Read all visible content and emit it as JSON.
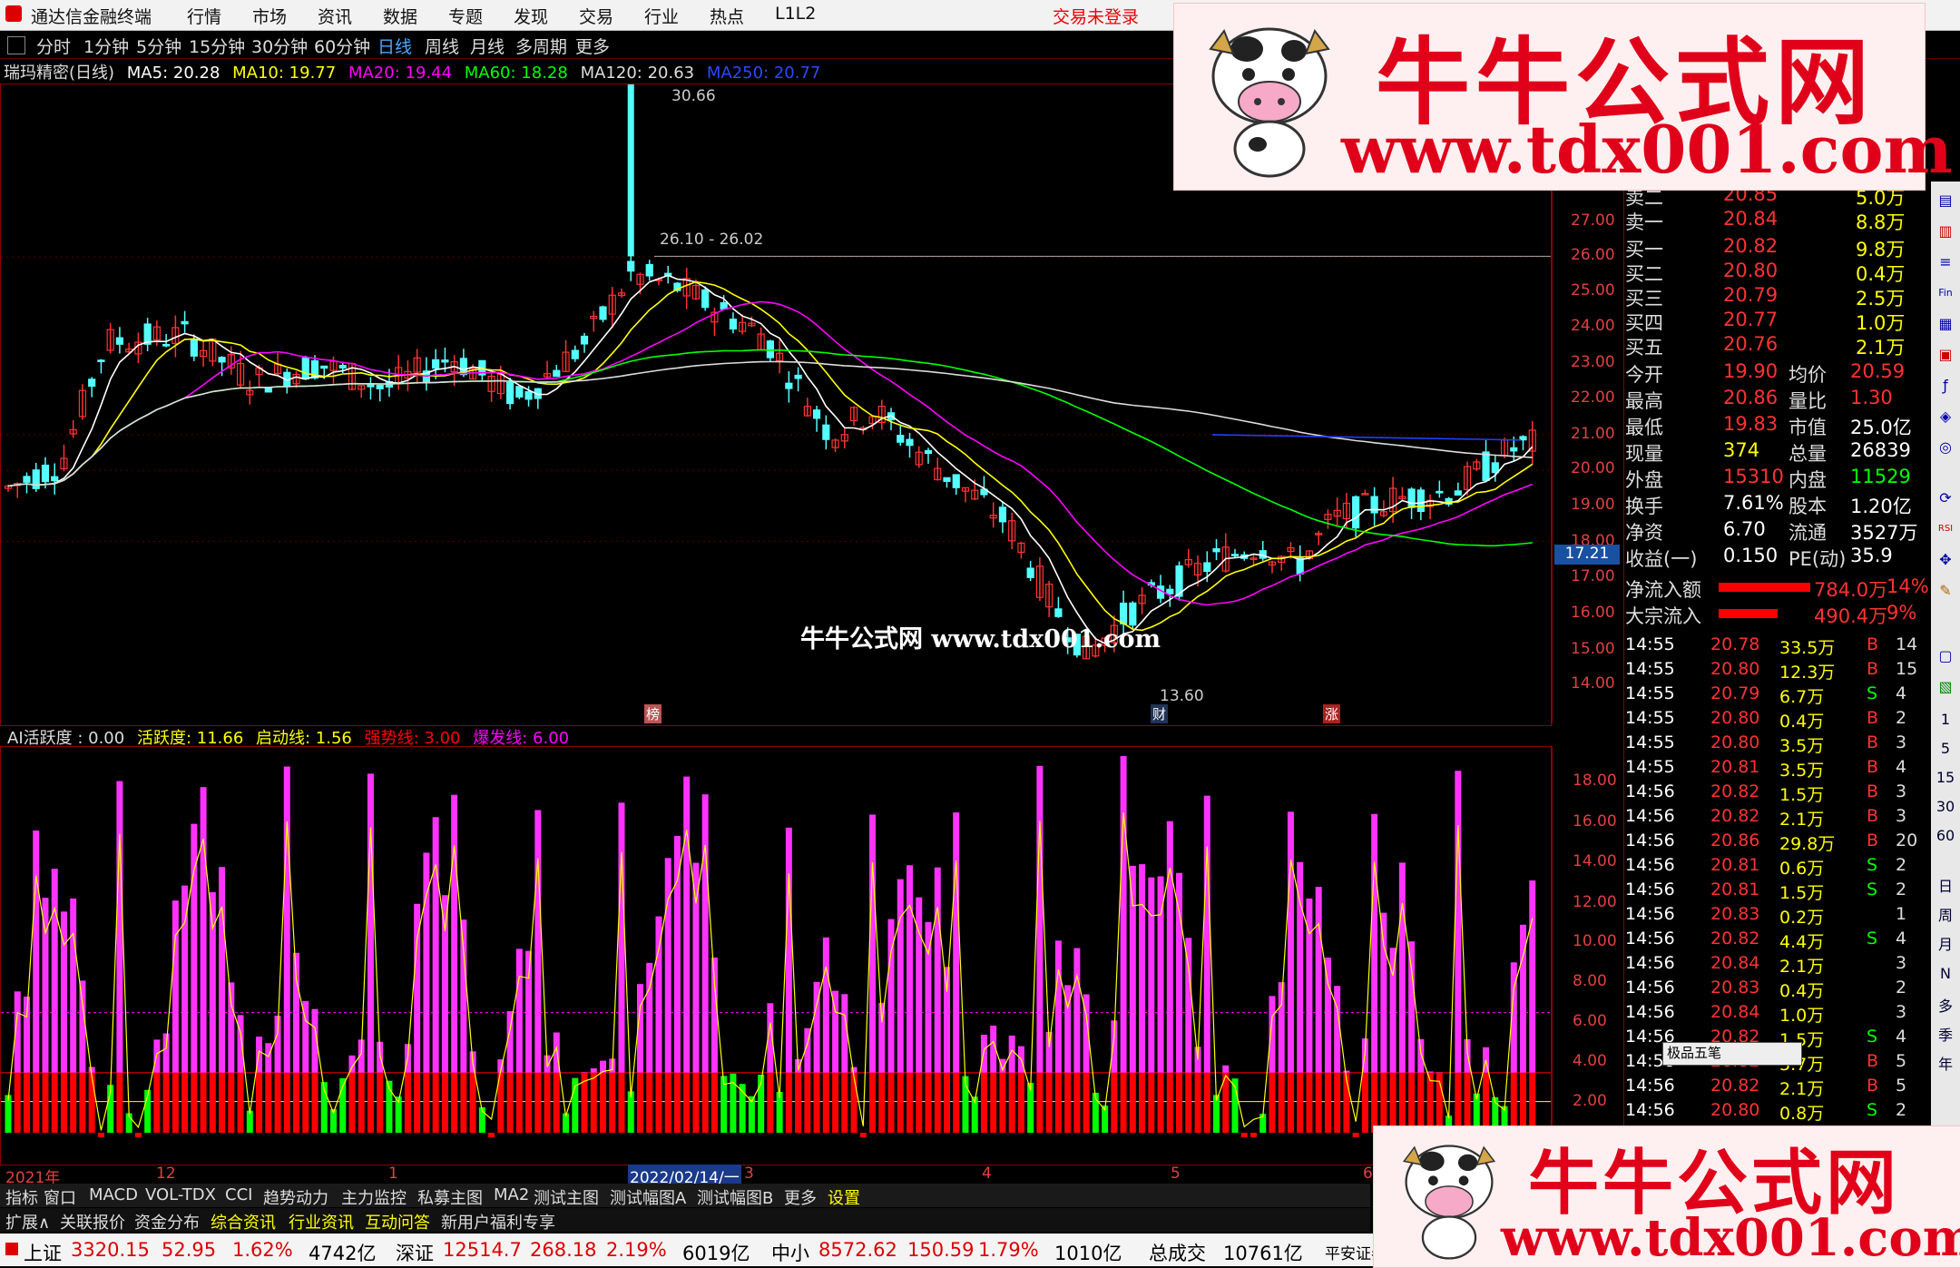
{
  "app": {
    "title": "通达信金融终端",
    "menu": [
      "行情",
      "市场",
      "资讯",
      "数据",
      "专题",
      "发现",
      "交易",
      "行业",
      "热点",
      "L1L2"
    ],
    "trade_status": "交易未登录"
  },
  "periods": [
    "分时",
    "1分钟",
    "5分钟",
    "15分钟",
    "30分钟",
    "60分钟",
    "日线",
    "周线",
    "月线",
    "多周期",
    "更多"
  ],
  "active_period": "日线",
  "ma_legend": {
    "stock": "瑞玛精密(日线)",
    "ma5": "MA5: 20.28",
    "ma10": "MA10: 19.77",
    "ma20": "MA20: 19.44",
    "ma60": "MA60: 18.28",
    "ma120": "MA120: 20.63",
    "ma250": "MA250: 20.77"
  },
  "price_axis": [
    "27.00",
    "26.00",
    "25.00",
    "24.00",
    "23.00",
    "22.00",
    "21.00",
    "20.00",
    "19.00",
    "18.00",
    "17.00",
    "16.00",
    "15.00",
    "14.00"
  ],
  "price_marker": "17.21",
  "annotations": {
    "high": "30.66",
    "range": "26.10 - 26.02",
    "low": "13.60",
    "event1": "榜",
    "event2": "财",
    "event3": "涨"
  },
  "watermark_center": "牛牛公式网 www.tdx001.com",
  "indicator_legend": {
    "name": "AI活跃度 : 0.00",
    "active": "活跃度: 11.66",
    "start": "启动线: 1.56",
    "strong": "强势线: 3.00",
    "burst": "爆发线: 6.00"
  },
  "indicator_axis": [
    "18.00",
    "16.00",
    "14.00",
    "12.00",
    "10.00",
    "8.00",
    "6.00",
    "4.00",
    "2.00"
  ],
  "time_axis": [
    "2021年",
    "12",
    "1",
    "2022/02/14/一",
    "3",
    "4",
    "5",
    "6"
  ],
  "quote": {
    "sell_rows": [
      {
        "label": "卖二",
        "price": "20.85",
        "vol": "5.0万"
      },
      {
        "label": "卖一",
        "price": "20.84",
        "vol": "8.8万"
      }
    ],
    "buy_rows": [
      {
        "label": "买一",
        "price": "20.82",
        "vol": "9.8万"
      },
      {
        "label": "买二",
        "price": "20.80",
        "vol": "0.4万"
      },
      {
        "label": "买三",
        "price": "20.79",
        "vol": "2.5万"
      },
      {
        "label": "买四",
        "price": "20.77",
        "vol": "1.0万"
      },
      {
        "label": "买五",
        "price": "20.76",
        "vol": "2.1万"
      }
    ],
    "stats": [
      {
        "l1": "今开",
        "v1": "19.90",
        "l2": "均价",
        "v2": "20.59"
      },
      {
        "l1": "最高",
        "v1": "20.86",
        "l2": "量比",
        "v2": "1.30"
      },
      {
        "l1": "最低",
        "v1": "19.83",
        "l2": "市值",
        "v2": "25.0亿"
      },
      {
        "l1": "现量",
        "v1": "374",
        "l2": "总量",
        "v2": "26839"
      },
      {
        "l1": "外盘",
        "v1": "15310",
        "l2": "内盘",
        "v2": "11529"
      },
      {
        "l1": "换手",
        "v1": "7.61%",
        "l2": "股本",
        "v2": "1.20亿"
      },
      {
        "l1": "净资",
        "v1": "6.70",
        "l2": "流通",
        "v2": "3527万"
      },
      {
        "l1": "收益(一)",
        "v1": "0.150",
        "l2": "PE(动)",
        "v2": "35.9"
      }
    ],
    "flows": [
      {
        "label": "净流入额",
        "value": "784.0万",
        "pct": "14%",
        "level": 0.14
      },
      {
        "label": "大宗流入",
        "value": "490.4万",
        "pct": "9%",
        "level": 0.09
      }
    ]
  },
  "ticks": [
    {
      "t": "14:55",
      "p": "20.78",
      "v": "33.5万",
      "d": "B",
      "n": "14"
    },
    {
      "t": "14:55",
      "p": "20.80",
      "v": "12.3万",
      "d": "B",
      "n": "15"
    },
    {
      "t": "14:55",
      "p": "20.79",
      "v": "6.7万",
      "d": "S",
      "n": "4"
    },
    {
      "t": "14:55",
      "p": "20.80",
      "v": "0.4万",
      "d": "B",
      "n": "2"
    },
    {
      "t": "14:55",
      "p": "20.80",
      "v": "3.5万",
      "d": "B",
      "n": "3"
    },
    {
      "t": "14:55",
      "p": "20.81",
      "v": "3.5万",
      "d": "B",
      "n": "4"
    },
    {
      "t": "14:56",
      "p": "20.82",
      "v": "1.5万",
      "d": "B",
      "n": "3"
    },
    {
      "t": "14:56",
      "p": "20.82",
      "v": "2.1万",
      "d": "B",
      "n": "3"
    },
    {
      "t": "14:56",
      "p": "20.86",
      "v": "29.8万",
      "d": "B",
      "n": "20"
    },
    {
      "t": "14:56",
      "p": "20.81",
      "v": "0.6万",
      "d": "S",
      "n": "2"
    },
    {
      "t": "14:56",
      "p": "20.81",
      "v": "1.5万",
      "d": "S",
      "n": "2"
    },
    {
      "t": "14:56",
      "p": "20.83",
      "v": "0.2万",
      "d": "",
      "n": "1"
    },
    {
      "t": "14:56",
      "p": "20.82",
      "v": "4.4万",
      "d": "S",
      "n": "4"
    },
    {
      "t": "14:56",
      "p": "20.84",
      "v": "2.1万",
      "d": "",
      "n": "3"
    },
    {
      "t": "14:56",
      "p": "20.83",
      "v": "0.4万",
      "d": "",
      "n": "2"
    },
    {
      "t": "14:56",
      "p": "20.84",
      "v": "1.0万",
      "d": "",
      "n": "3"
    },
    {
      "t": "14:56",
      "p": "20.82",
      "v": "1.5万",
      "d": "S",
      "n": "4"
    },
    {
      "t": "14:56",
      "p": "20.82",
      "v": "3.7万",
      "d": "B",
      "n": "5"
    },
    {
      "t": "14:56",
      "p": "20.82",
      "v": "2.1万",
      "d": "B",
      "n": "5"
    },
    {
      "t": "14:56",
      "p": "20.80",
      "v": "0.8万",
      "d": "S",
      "n": "2"
    }
  ],
  "popup_label": "极品五笔",
  "sidebar_buttons": [
    "日",
    "周",
    "月",
    "N",
    "多",
    "季",
    "年",
    "1",
    "5",
    "15",
    "30",
    "60"
  ],
  "bottom_tabs": [
    "指标",
    "窗口",
    "MACD",
    "VOL-TDX",
    "CCI",
    "趋势动力",
    "主力监控",
    "私募主图",
    "MA2",
    "测试主图",
    "测试幅图A",
    "测试幅图B",
    "更多",
    "设置"
  ],
  "ext_tabs": [
    "扩展∧",
    "关联报价",
    "资金分布",
    "综合资讯",
    "行业资讯",
    "互动问答",
    "新用户福利专享"
  ],
  "status": [
    {
      "name": "上证",
      "val": "3320.15",
      "chg": "52.95",
      "pct": "1.62%",
      "amt": "4742亿"
    },
    {
      "name": "深证",
      "val": "12514.7",
      "chg": "268.18",
      "pct": "2.19%",
      "amt": "6019亿"
    },
    {
      "name": "中小",
      "val": "8572.62",
      "chg": "150.59",
      "pct": "1.79%",
      "amt": "1010亿"
    }
  ],
  "status_total_label": "总成交",
  "status_total_value": "10761亿",
  "status_broker": "平安证券",
  "banner": {
    "title": "牛牛公式网",
    "url": "www.tdx001.com"
  },
  "colors": {
    "up": "#ff3232",
    "down": "#54ffff",
    "ma5": "#ffffff",
    "ma10": "#ffff00",
    "ma20": "#ff00ff",
    "ma60": "#00ff00",
    "ma120": "#dcdcdc",
    "ma250": "#2040ff",
    "indicator_bar": "#ff33ff",
    "indicator_base": "#ff0000",
    "indicator_green": "#00ff00"
  }
}
